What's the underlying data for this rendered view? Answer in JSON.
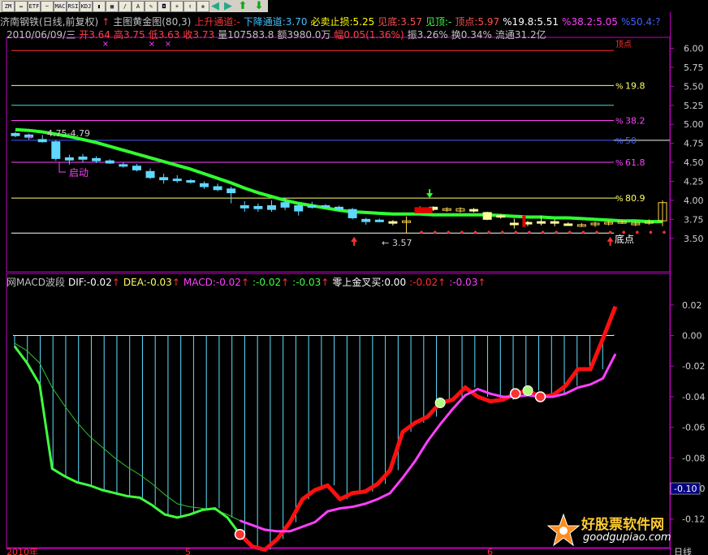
{
  "header": {
    "stock": "济南钢铁(日线,前复权)",
    "indicator": "主图黄金图(80,3)",
    "up_channel": "上升通道:-",
    "down_channel": "下降通道:3.70",
    "stop_loss": "必卖止损:5.25",
    "bottom": "见底:3.57",
    "top": "见顶:-",
    "top_point": "顶点:5.97",
    "pct198": "%19.8:5.51",
    "pct382": "%38.2:5.05",
    "pct504": "%50.4:?"
  },
  "quote": {
    "date": "2010/06/09/三",
    "open": "开3.64",
    "high": "高3.75",
    "low": "低3.63",
    "close": "收3.73",
    "volume": "量107583.8",
    "amount": "额3980.0万",
    "change": "幅0.05(1.36%)",
    "amplitude": "振3.26%",
    "turnover": "换0.34%",
    "float": "流通31.2亿"
  },
  "macd_header": {
    "name": "网MACD波段",
    "dif": "DIF:-0.02",
    "dea": "DEA:-0.03",
    "macd": "MACD:-0.02",
    "v1": ":-0.02",
    "v2": ":-0.03",
    "cross": "零上金叉买:0.00",
    "v3": ":-0.02",
    "v4": ":-0.03"
  },
  "annotations": {
    "range_label": "4.75-4.79",
    "start_label": "启动",
    "low_label": "3.57",
    "bottom_point": "底点",
    "fib_198": "19.8",
    "fib_382": "38.2",
    "fib_618": "61.8",
    "fib_809": "80.9",
    "fib_50": "50",
    "top_marker": "顶点",
    "macd_current": "-0.10"
  },
  "bottom_bar": {
    "year": "2010年",
    "month5": "5",
    "month6": "6",
    "right": "日线"
  },
  "watermark": {
    "title": "好股票软件网",
    "url": "goodgupiao.com"
  },
  "toolbar": {
    "icons": [
      "up-arrow-icon",
      "right-arrow-icon",
      "grid-icon",
      "left-arrow-icon",
      "macd-icon",
      "rsi-icon",
      "kdj-icon",
      "bar-icon",
      "pen-icon",
      "move-icon",
      "down-icon",
      "up-green-icon",
      "down-green-icon"
    ]
  },
  "chart_data": [
    {
      "type": "candlestick",
      "title": "主图黄金图(80,3)",
      "y_ticks": [
        "6.00",
        "5.75",
        "5.50",
        "5.25",
        "5.00",
        "4.75",
        "4.50",
        "4.25",
        "4.00",
        "3.75",
        "3.50"
      ],
      "ylim": [
        3.38,
        6.08
      ],
      "candles": [
        {
          "o": 4.88,
          "c": 4.85,
          "h": 4.9,
          "l": 4.83
        },
        {
          "o": 4.86,
          "c": 4.83,
          "h": 4.88,
          "l": 4.8
        },
        {
          "o": 4.8,
          "c": 4.77,
          "h": 4.86,
          "l": 4.76
        },
        {
          "o": 4.77,
          "c": 4.55,
          "h": 4.79,
          "l": 4.52
        },
        {
          "o": 4.56,
          "c": 4.53,
          "h": 4.6,
          "l": 4.47
        },
        {
          "o": 4.57,
          "c": 4.54,
          "h": 4.61,
          "l": 4.5
        },
        {
          "o": 4.55,
          "c": 4.52,
          "h": 4.58,
          "l": 4.49
        },
        {
          "o": 4.52,
          "c": 4.49,
          "h": 4.54,
          "l": 4.48
        },
        {
          "o": 4.47,
          "c": 4.45,
          "h": 4.5,
          "l": 4.43
        },
        {
          "o": 4.45,
          "c": 4.4,
          "h": 4.48,
          "l": 4.38
        },
        {
          "o": 4.38,
          "c": 4.3,
          "h": 4.42,
          "l": 4.28
        },
        {
          "o": 4.3,
          "c": 4.27,
          "h": 4.35,
          "l": 4.22
        },
        {
          "o": 4.28,
          "c": 4.27,
          "h": 4.33,
          "l": 4.23
        },
        {
          "o": 4.26,
          "c": 4.24,
          "h": 4.28,
          "l": 4.22
        },
        {
          "o": 4.22,
          "c": 4.18,
          "h": 4.25,
          "l": 4.15
        },
        {
          "o": 4.18,
          "c": 4.14,
          "h": 4.22,
          "l": 4.12
        },
        {
          "o": 4.15,
          "c": 4.1,
          "h": 4.18,
          "l": 3.96
        },
        {
          "o": 3.93,
          "c": 3.9,
          "h": 3.99,
          "l": 3.85
        },
        {
          "o": 3.92,
          "c": 3.89,
          "h": 3.96,
          "l": 3.85
        },
        {
          "o": 3.93,
          "c": 3.88,
          "h": 4.0,
          "l": 3.85
        },
        {
          "o": 3.97,
          "c": 3.91,
          "h": 4.03,
          "l": 3.87
        },
        {
          "o": 3.93,
          "c": 3.86,
          "h": 3.96,
          "l": 3.8
        },
        {
          "o": 3.93,
          "c": 3.91,
          "h": 3.98,
          "l": 3.89
        },
        {
          "o": 3.93,
          "c": 3.91,
          "h": 3.95,
          "l": 3.89
        },
        {
          "o": 3.91,
          "c": 3.88,
          "h": 3.93,
          "l": 3.87
        },
        {
          "o": 3.88,
          "c": 3.77,
          "h": 3.9,
          "l": 3.75
        },
        {
          "o": 3.75,
          "c": 3.72,
          "h": 3.77,
          "l": 3.68
        },
        {
          "o": 3.74,
          "c": 3.73,
          "h": 3.76,
          "l": 3.72
        },
        {
          "o": 3.72,
          "c": 3.7,
          "h": 3.74,
          "l": 3.67
        },
        {
          "o": 3.71,
          "c": 3.73,
          "h": 3.79,
          "l": 3.57
        },
        {
          "o": 3.9,
          "c": 3.88,
          "h": 3.92,
          "l": 3.86
        },
        {
          "o": 3.91,
          "c": 3.88,
          "h": 3.92,
          "l": 3.86
        },
        {
          "o": 3.87,
          "c": 3.89,
          "h": 3.91,
          "l": 3.85
        },
        {
          "o": 3.86,
          "c": 3.89,
          "h": 3.91,
          "l": 3.84
        },
        {
          "o": 3.88,
          "c": 3.86,
          "h": 3.9,
          "l": 3.84
        },
        {
          "o": 3.84,
          "c": 3.75,
          "h": 3.85,
          "l": 3.74
        },
        {
          "o": 3.8,
          "c": 3.78,
          "h": 3.82,
          "l": 3.76
        },
        {
          "o": 3.7,
          "c": 3.69,
          "h": 3.76,
          "l": 3.63
        },
        {
          "o": 3.71,
          "c": 3.69,
          "h": 3.73,
          "l": 3.66
        },
        {
          "o": 3.72,
          "c": 3.71,
          "h": 3.8,
          "l": 3.67
        },
        {
          "o": 3.72,
          "c": 3.7,
          "h": 3.75,
          "l": 3.66
        },
        {
          "o": 3.69,
          "c": 3.68,
          "h": 3.71,
          "l": 3.67
        },
        {
          "o": 3.67,
          "c": 3.68,
          "h": 3.7,
          "l": 3.65
        },
        {
          "o": 3.68,
          "c": 3.7,
          "h": 3.72,
          "l": 3.65
        },
        {
          "o": 3.7,
          "c": 3.71,
          "h": 3.73,
          "l": 3.67
        },
        {
          "o": 3.71,
          "c": 3.72,
          "h": 3.74,
          "l": 3.69
        },
        {
          "o": 3.69,
          "c": 3.7,
          "h": 3.72,
          "l": 3.66
        },
        {
          "o": 3.7,
          "c": 3.72,
          "h": 3.75,
          "l": 3.68
        },
        {
          "o": 3.73,
          "c": 3.97,
          "h": 4.0,
          "l": 3.66
        }
      ],
      "ma_line": [
        4.93,
        4.92,
        4.9,
        4.87,
        4.84,
        4.8,
        4.76,
        4.71,
        4.66,
        4.61,
        4.56,
        4.51,
        4.46,
        4.41,
        4.35,
        4.29,
        4.23,
        4.16,
        4.1,
        4.05,
        4.0,
        3.96,
        3.93,
        3.9,
        3.87,
        3.85,
        3.84,
        3.83,
        3.82,
        3.82,
        3.82,
        3.81,
        3.81,
        3.81,
        3.81,
        3.81,
        3.8,
        3.79,
        3.78,
        3.78,
        3.77,
        3.77,
        3.76,
        3.75,
        3.74,
        3.73,
        3.73,
        3.72,
        3.72
      ],
      "horizontal_lines": [
        {
          "value": 5.97,
          "color": "#ff3030",
          "label": "顶点"
        },
        {
          "value": 5.51,
          "color": "#ffff66",
          "label": "19.8"
        },
        {
          "value": 5.25,
          "color": "#40e0d0",
          "label": ""
        },
        {
          "value": 5.05,
          "color": "#ff40ff",
          "label": "38.2"
        },
        {
          "value": 4.79,
          "color": "#4060ff",
          "label": "50"
        },
        {
          "value": 4.5,
          "color": "#ff40ff",
          "label": "61.8"
        },
        {
          "value": 4.03,
          "color": "#ffff66",
          "label": "80.9"
        },
        {
          "value": 3.57,
          "color": "#ffffff",
          "label": ""
        }
      ]
    },
    {
      "type": "macd",
      "title": "网MACD波段",
      "y_ticks": [
        "0.02",
        "0.00",
        "-0.02",
        "-0.04",
        "-0.06",
        "-0.08",
        "-0.10",
        "-0.12"
      ],
      "ylim": [
        -0.135,
        0.03
      ],
      "dif": [
        -0.007,
        -0.018,
        -0.032,
        -0.087,
        -0.092,
        -0.096,
        -0.098,
        -0.101,
        -0.103,
        -0.105,
        -0.106,
        -0.111,
        -0.117,
        -0.119,
        -0.117,
        -0.114,
        -0.113,
        -0.119,
        -0.13,
        -0.138,
        -0.14,
        -0.133,
        -0.122,
        -0.107,
        -0.101,
        -0.098,
        -0.107,
        -0.103,
        -0.102,
        -0.097,
        -0.088,
        -0.063,
        -0.057,
        -0.053,
        -0.044,
        -0.042,
        -0.034,
        -0.04,
        -0.043,
        -0.042,
        -0.038,
        -0.036,
        -0.04,
        -0.039,
        -0.033,
        -0.022,
        -0.022,
        -0.002,
        0.019
      ],
      "dea": [
        -0.005,
        -0.01,
        -0.018,
        -0.034,
        -0.046,
        -0.057,
        -0.066,
        -0.073,
        -0.08,
        -0.086,
        -0.091,
        -0.097,
        -0.104,
        -0.11,
        -0.112,
        -0.113,
        -0.114,
        -0.117,
        -0.121,
        -0.124,
        -0.127,
        -0.128,
        -0.128,
        -0.125,
        -0.122,
        -0.115,
        -0.113,
        -0.112,
        -0.11,
        -0.107,
        -0.103,
        -0.093,
        -0.082,
        -0.069,
        -0.058,
        -0.048,
        -0.039,
        -0.035,
        -0.038,
        -0.04,
        -0.04,
        -0.039,
        -0.04,
        -0.04,
        -0.038,
        -0.034,
        -0.032,
        -0.028,
        -0.012
      ],
      "red_from_index": 18
    }
  ]
}
